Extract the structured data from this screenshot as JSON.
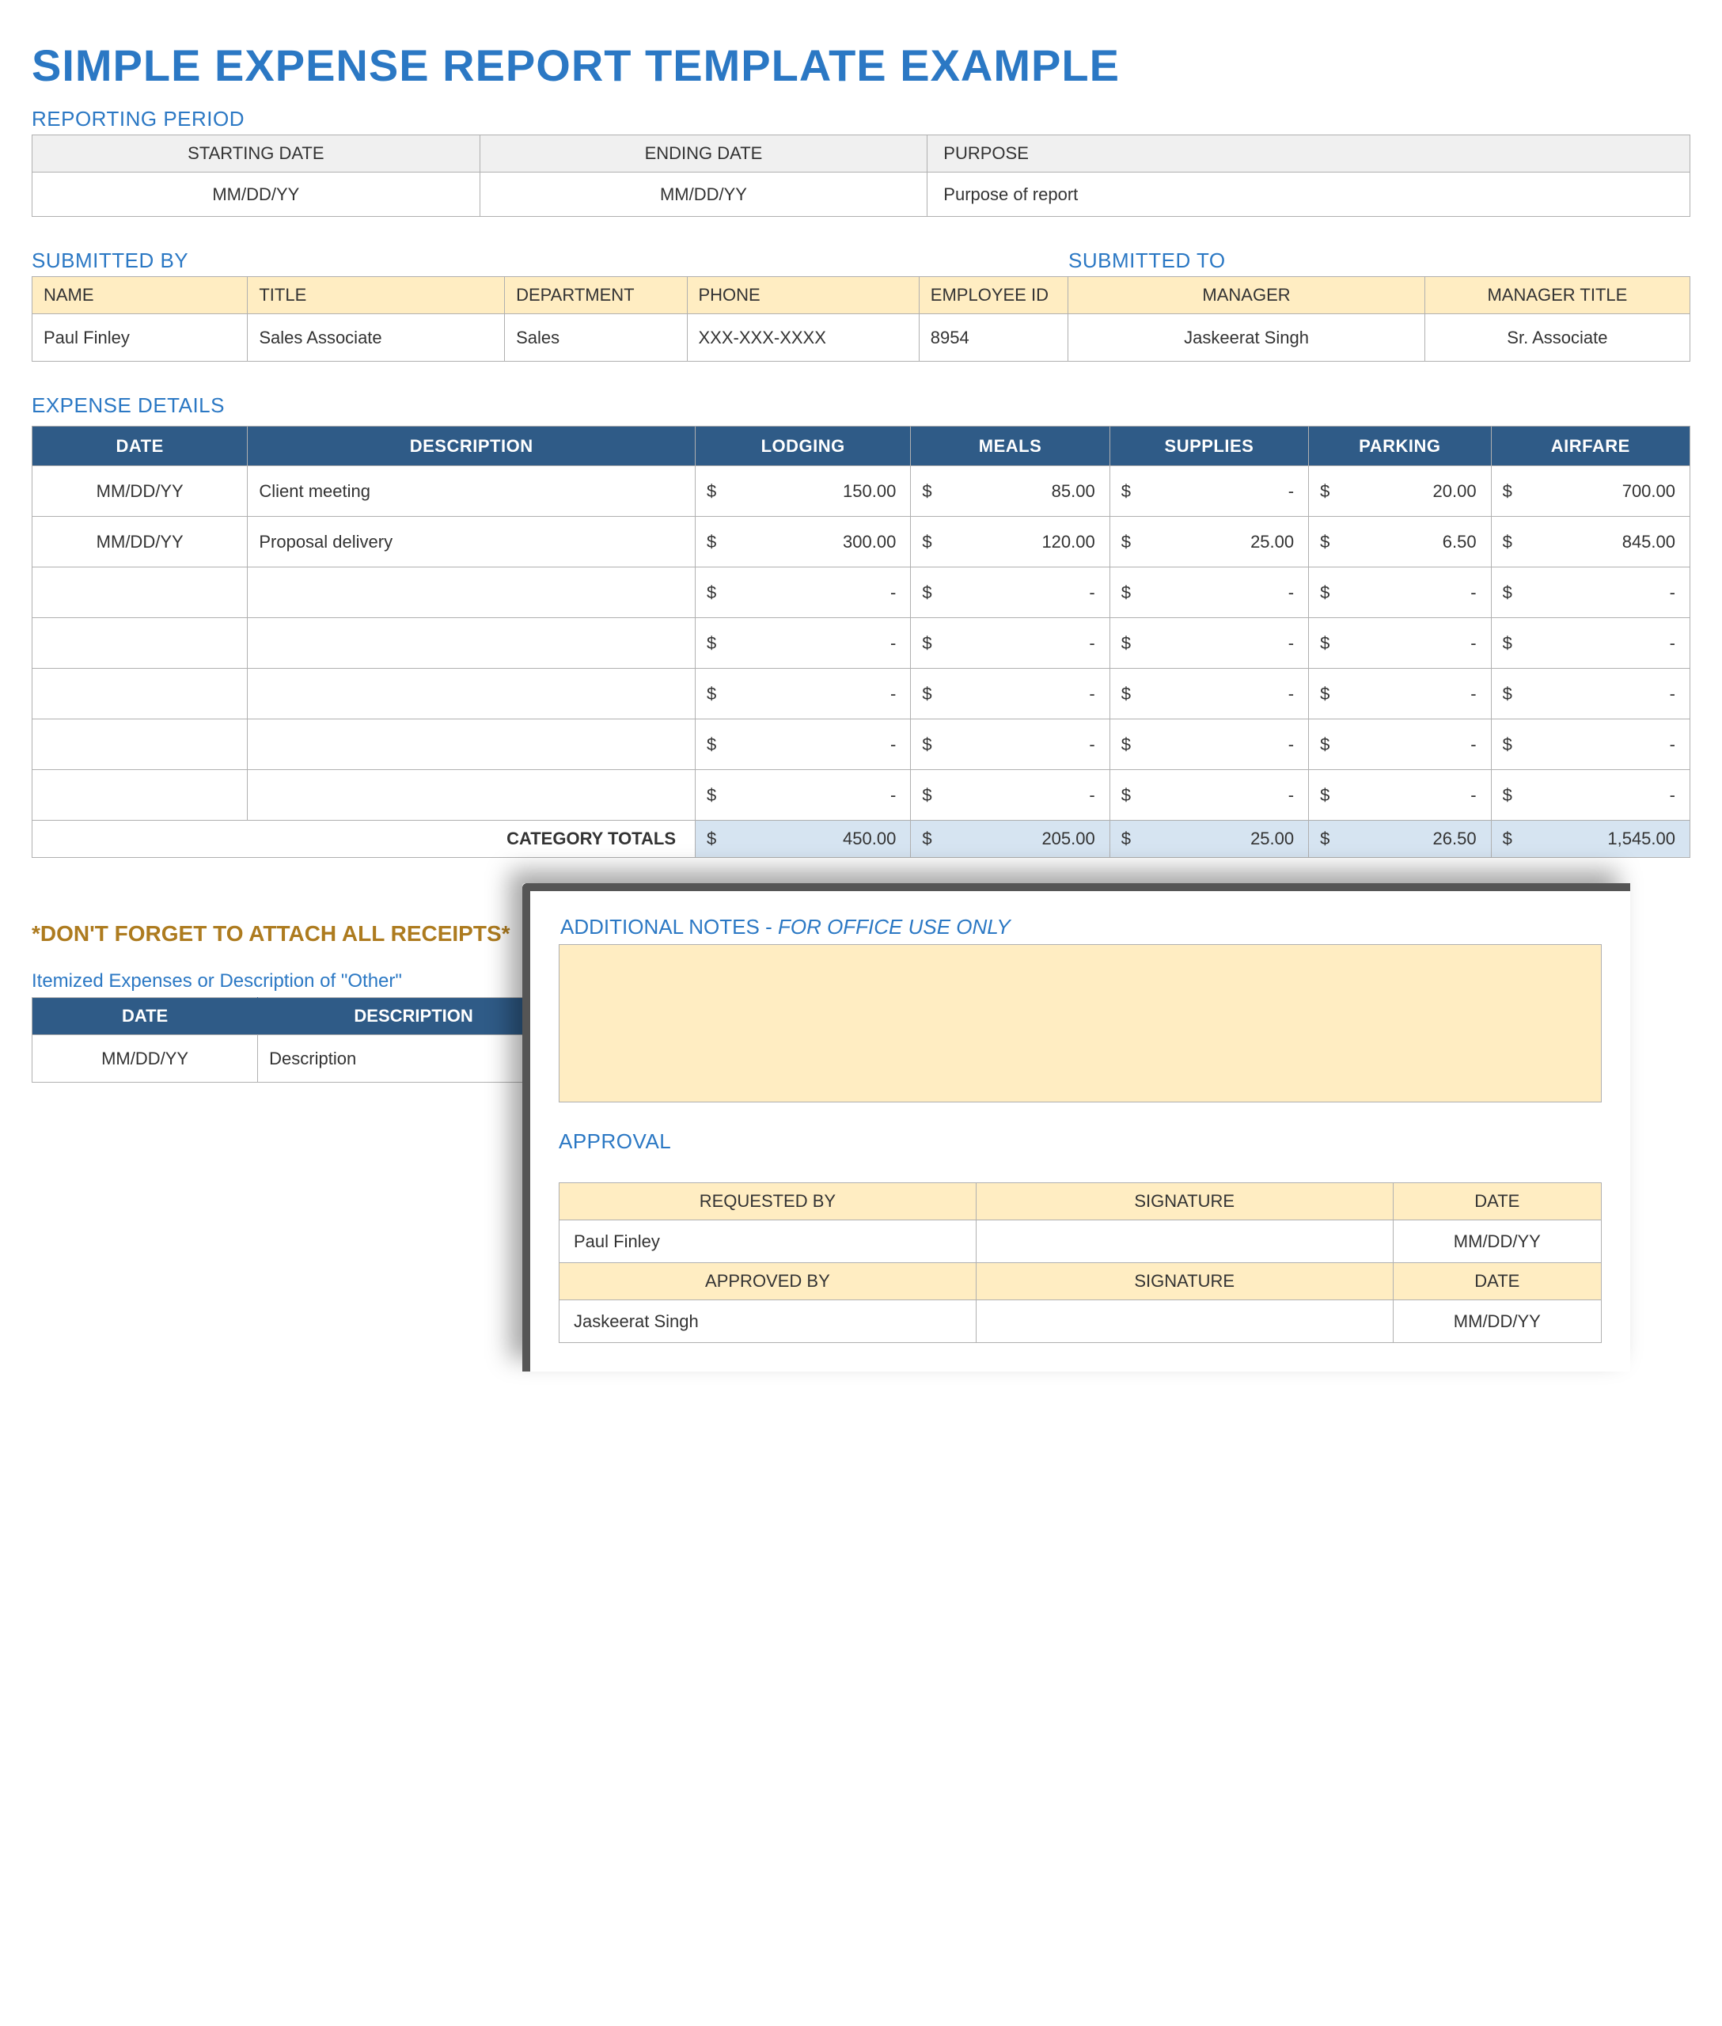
{
  "title": "SIMPLE EXPENSE REPORT TEMPLATE EXAMPLE",
  "reporting_period": {
    "section_title": "REPORTING PERIOD",
    "headers": {
      "start": "STARTING DATE",
      "end": "ENDING DATE",
      "purpose": "PURPOSE"
    },
    "values": {
      "start": "MM/DD/YY",
      "end": "MM/DD/YY",
      "purpose": "Purpose of report"
    }
  },
  "submitted": {
    "by_title": "SUBMITTED BY",
    "to_title": "SUBMITTED TO",
    "headers": {
      "name": "NAME",
      "title": "TITLE",
      "department": "DEPARTMENT",
      "phone": "PHONE",
      "employee_id": "EMPLOYEE ID",
      "manager": "MANAGER",
      "manager_title": "MANAGER TITLE"
    },
    "values": {
      "name": "Paul Finley",
      "title": "Sales Associate",
      "department": "Sales",
      "phone": "XXX-XXX-XXXX",
      "employee_id": "8954",
      "manager": "Jaskeerat Singh",
      "manager_title": "Sr. Associate"
    }
  },
  "expense_details": {
    "section_title": "EXPENSE DETAILS",
    "headers": {
      "date": "DATE",
      "description": "DESCRIPTION",
      "lodging": "LODGING",
      "meals": "MEALS",
      "supplies": "SUPPLIES",
      "parking": "PARKING",
      "airfare": "AIRFARE"
    },
    "rows": [
      {
        "date": "MM/DD/YY",
        "description": "Client meeting",
        "lodging": "150.00",
        "meals": "85.00",
        "supplies": "-",
        "parking": "20.00",
        "airfare": "700.00"
      },
      {
        "date": "MM/DD/YY",
        "description": "Proposal delivery",
        "lodging": "300.00",
        "meals": "120.00",
        "supplies": "25.00",
        "parking": "6.50",
        "airfare": "845.00"
      },
      {
        "date": "",
        "description": "",
        "lodging": "-",
        "meals": "-",
        "supplies": "-",
        "parking": "-",
        "airfare": "-"
      },
      {
        "date": "",
        "description": "",
        "lodging": "-",
        "meals": "-",
        "supplies": "-",
        "parking": "-",
        "airfare": "-"
      },
      {
        "date": "",
        "description": "",
        "lodging": "-",
        "meals": "-",
        "supplies": "-",
        "parking": "-",
        "airfare": "-"
      },
      {
        "date": "",
        "description": "",
        "lodging": "-",
        "meals": "-",
        "supplies": "-",
        "parking": "-",
        "airfare": "-"
      },
      {
        "date": "",
        "description": "",
        "lodging": "-",
        "meals": "-",
        "supplies": "-",
        "parking": "-",
        "airfare": "-"
      }
    ],
    "totals_label": "CATEGORY TOTALS",
    "totals": {
      "lodging": "450.00",
      "meals": "205.00",
      "supplies": "25.00",
      "parking": "26.50",
      "airfare": "1,545.00"
    },
    "currency": "$"
  },
  "receipts_note": "*DON'T FORGET TO ATTACH ALL RECEIPTS*",
  "itemized": {
    "caption": "Itemized Expenses or Description of \"Other\"",
    "headers": {
      "date": "DATE",
      "description": "DESCRIPTION"
    },
    "row": {
      "date": "MM/DD/YY",
      "description": "Description"
    }
  },
  "overlay": {
    "notes_title_a": "ADDITIONAL NOTES - ",
    "notes_title_b": "FOR OFFICE USE ONLY",
    "approval_title": "APPROVAL",
    "headers1": {
      "requested_by": "REQUESTED BY",
      "signature": "SIGNATURE",
      "date": "DATE"
    },
    "row1": {
      "requested_by": "Paul Finley",
      "signature": "",
      "date": "MM/DD/YY"
    },
    "headers2": {
      "approved_by": "APPROVED BY",
      "signature": "SIGNATURE",
      "date": "DATE"
    },
    "row2": {
      "approved_by": "Jaskeerat Singh",
      "signature": "",
      "date": "MM/DD/YY"
    }
  }
}
